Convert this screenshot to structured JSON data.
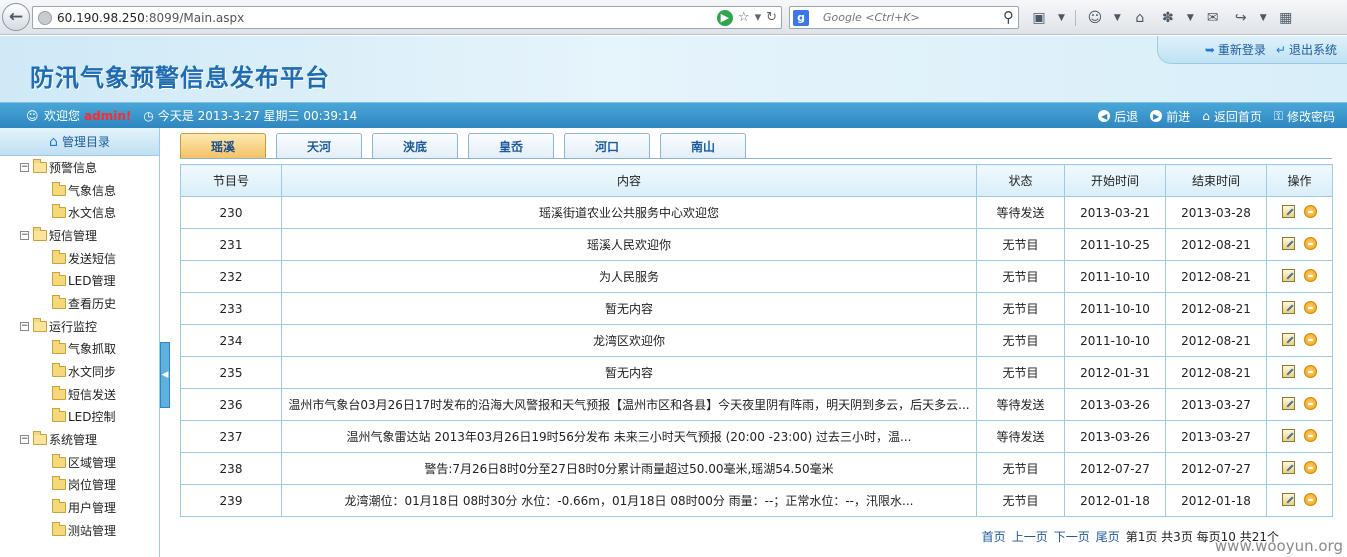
{
  "browser": {
    "url_host": "60.190.98.250",
    "url_rest": ":8099/Main.aspx",
    "search_placeholder": "Google <Ctrl+K>"
  },
  "header": {
    "title": "防汛气象预警信息发布平台",
    "relogin": "重新登录",
    "logout": "退出系统"
  },
  "infobar": {
    "welcome": "欢迎您",
    "user": "admin!",
    "today": "今天是 2013-3-27 星期三 00:39:14",
    "back": "后退",
    "forward": "前进",
    "home": "返回首页",
    "change_password": "修改密码"
  },
  "sidebar": {
    "title": "管理目录",
    "groups": [
      {
        "label": "预警信息",
        "items": [
          "气象信息",
          "水文信息"
        ]
      },
      {
        "label": "短信管理",
        "items": [
          "发送短信",
          "LED管理",
          "查看历史"
        ]
      },
      {
        "label": "运行监控",
        "items": [
          "气象抓取",
          "水文同步",
          "短信发送",
          "LED控制"
        ]
      },
      {
        "label": "系统管理",
        "items": [
          "区域管理",
          "岗位管理",
          "用户管理",
          "测站管理"
        ]
      }
    ]
  },
  "tabs": [
    "瑶溪",
    "天河",
    "浃底",
    "皇岙",
    "河口",
    "南山"
  ],
  "table": {
    "headers": [
      "节目号",
      "内容",
      "状态",
      "开始时间",
      "结束时间",
      "操作"
    ],
    "rows": [
      [
        "230",
        "瑶溪街道农业公共服务中心欢迎您",
        "等待发送",
        "2013-03-21",
        "2013-03-28"
      ],
      [
        "231",
        "瑶溪人民欢迎你",
        "无节目",
        "2011-10-25",
        "2012-08-21"
      ],
      [
        "232",
        "为人民服务",
        "无节目",
        "2011-10-10",
        "2012-08-21"
      ],
      [
        "233",
        "暂无内容",
        "无节目",
        "2011-10-10",
        "2012-08-21"
      ],
      [
        "234",
        "龙湾区欢迎你",
        "无节目",
        "2011-10-10",
        "2012-08-21"
      ],
      [
        "235",
        "暂无内容",
        "无节目",
        "2012-01-31",
        "2012-08-21"
      ],
      [
        "236",
        "温州市气象台03月26日17时发布的沿海大风警报和天气预报【温州市区和各县】今天夜里阴有阵雨，明天阴到多云，后天多云...",
        "等待发送",
        "2013-03-26",
        "2013-03-27"
      ],
      [
        "237",
        "温州气象雷达站 2013年03月26日19时56分发布 未来三小时天气预报 (20:00 -23:00) 过去三小时，温...",
        "等待发送",
        "2013-03-26",
        "2013-03-27"
      ],
      [
        "238",
        "警告:7月26日8时0分至27日8时0分累计雨量超过50.00毫米,瑶湖54.50毫米",
        "无节目",
        "2012-07-27",
        "2012-07-27"
      ],
      [
        "239",
        "龙湾潮位：01月18日 08时30分 水位：-0.66m，01月18日 08时00分 雨量：--；正常水位：--，汛限水...",
        "无节目",
        "2012-01-18",
        "2012-01-18"
      ]
    ]
  },
  "pager": {
    "first": "首页",
    "prev": "上一页",
    "next": "下一页",
    "last": "尾页",
    "info": "第1页 共3页 每页10 共21个"
  },
  "watermark": "www.wooyun.org",
  "colors": {
    "accent": "#2e87c0",
    "header_title": "#1f6cb3",
    "admin": "#ff2a2a",
    "active_tab": "#f3c267"
  }
}
